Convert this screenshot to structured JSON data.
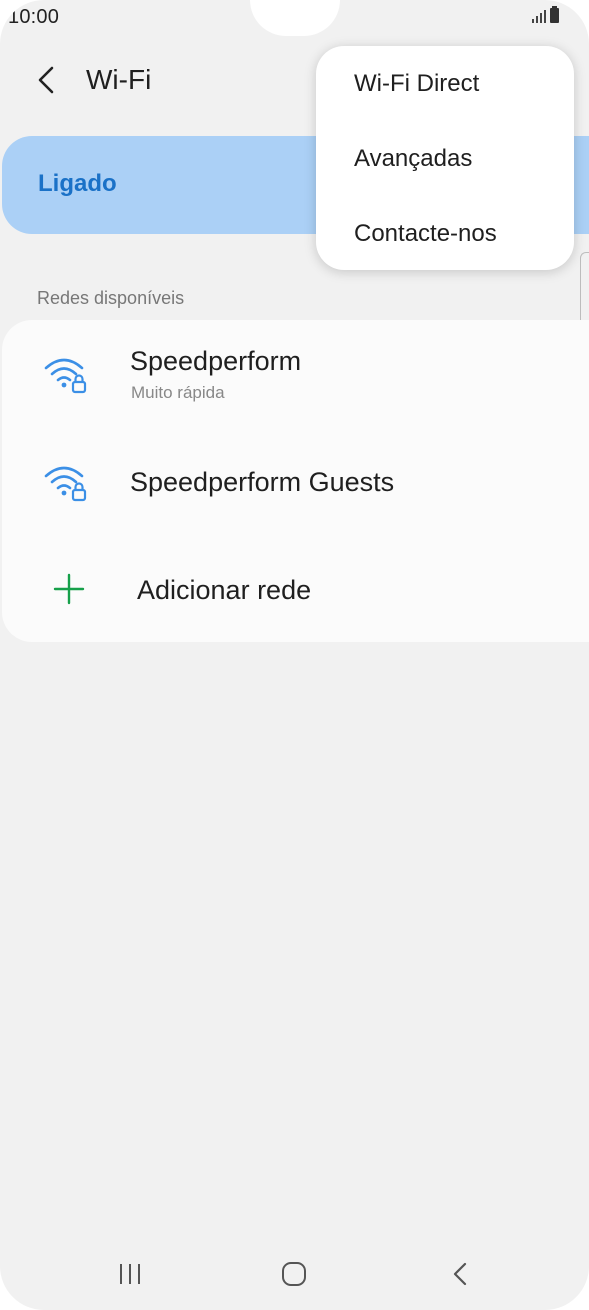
{
  "status_bar": {
    "time": "10:00"
  },
  "header": {
    "title": "Wi-Fi"
  },
  "wifi_toggle": {
    "label": "Ligado"
  },
  "networks": {
    "section_label": "Redes disponíveis",
    "items": [
      {
        "name": "Speedperform",
        "subtitle": "Muito rápida",
        "icon": "wifi-lock-icon"
      },
      {
        "name": "Speedperform Guests",
        "icon": "wifi-lock-icon"
      }
    ],
    "add_label": "Adicionar rede"
  },
  "menu": {
    "items": [
      "Wi-Fi Direct",
      "Avançadas",
      "Contacte-nos"
    ]
  },
  "colors": {
    "accent": "#1a71c7",
    "toggle_bg": "#abd0f6",
    "wifi_icon": "#3b8fe6",
    "add_icon": "#16a04a"
  }
}
